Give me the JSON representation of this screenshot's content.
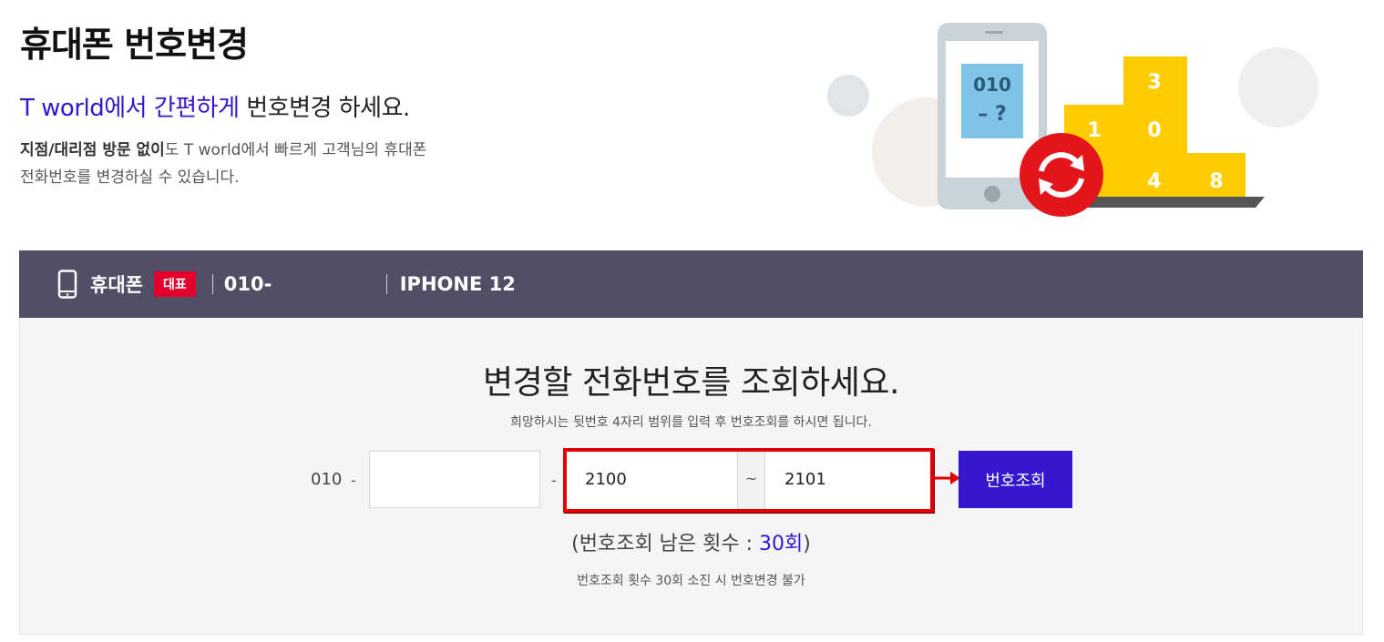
{
  "header": {
    "title": "휴대폰 번호변경",
    "subtitle_accent": "T world에서 간편하게",
    "subtitle_rest": " 번호변경 하세요.",
    "desc_bold": "지점/대리점 방문 없이",
    "desc_line1_rest": "도 T world에서 빠르게 고객님의 휴대폰",
    "desc_line2": "전화번호를 변경하실 수 있습니다."
  },
  "illustration": {
    "screen_line1": "010",
    "screen_line2": "– ?",
    "tiles": [
      "3",
      "1",
      "0",
      "4",
      "8"
    ]
  },
  "device": {
    "icon": "mobile-phone-icon",
    "label": "휴대폰",
    "badge": "대표",
    "number": "010-",
    "model": "IPHONE 12"
  },
  "search": {
    "title": "변경할 전화번호를 조회하세요.",
    "guide": "희망하시는 뒷번호 4자리 범위를 입력 후 번호조회를 하시면 됩니다.",
    "prefix": "010",
    "dash": "-",
    "middle_value": "",
    "range_from": "2100",
    "tilde": "~",
    "range_to": "2101",
    "button_label": "번호조회",
    "remain_prefix": "(번호조회 남은 횟수 : ",
    "remain_count": "30회",
    "remain_suffix": ")",
    "notice": "번호조회 횟수 30회 소진 시 번호변경 불가"
  },
  "colors": {
    "accent": "#3617ce",
    "bar": "#514e66",
    "badge": "#e3002c",
    "highlight": "#e30000"
  }
}
